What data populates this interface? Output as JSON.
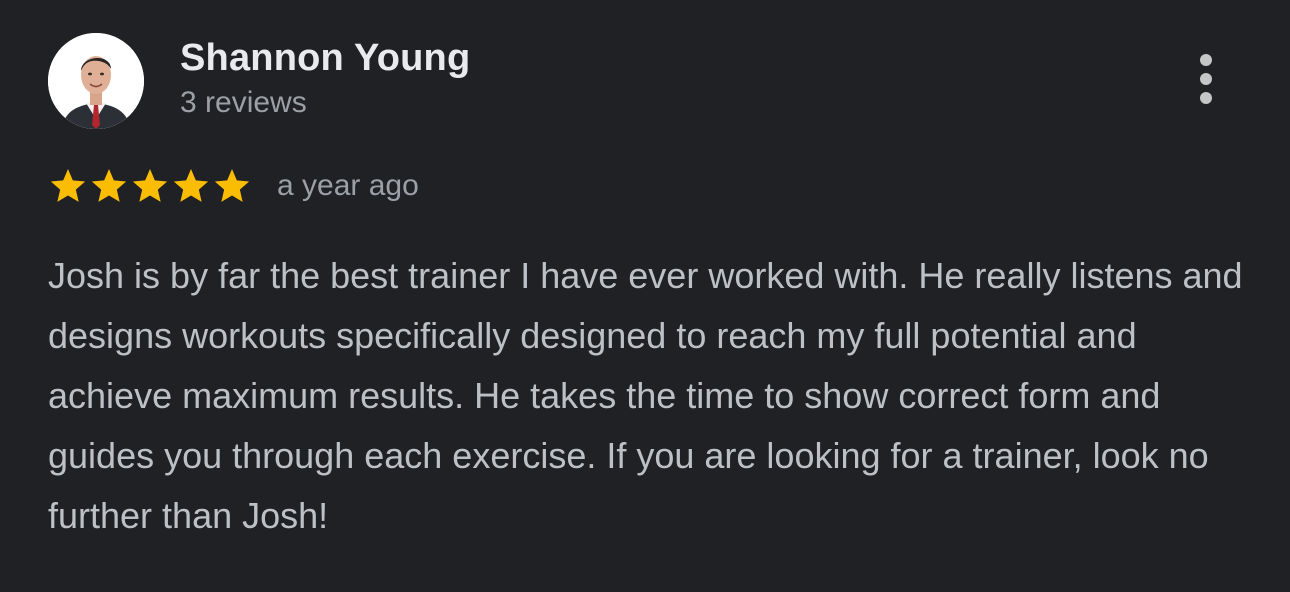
{
  "reviewer": {
    "name": "Shannon Young",
    "review_count": "3 reviews",
    "avatar": "profile-photo"
  },
  "actions": {
    "more_icon": "more-vertical-icon"
  },
  "rating": {
    "stars": 5,
    "max_stars": 5,
    "star_color": "#fbbc04",
    "time": "a year ago"
  },
  "review": {
    "text": "Josh is by far the best trainer I have ever worked with. He really listens and designs workouts specifically designed to reach my full potential and achieve maximum results. He takes the time to show correct form and guides you through each exercise. If you are looking for a trainer, look no further than Josh!"
  },
  "colors": {
    "background": "#202124",
    "name_text": "#e8eaed",
    "secondary_text": "#9aa0a6",
    "body_text": "#bdc1c6",
    "icon": "#c4c7c5"
  }
}
